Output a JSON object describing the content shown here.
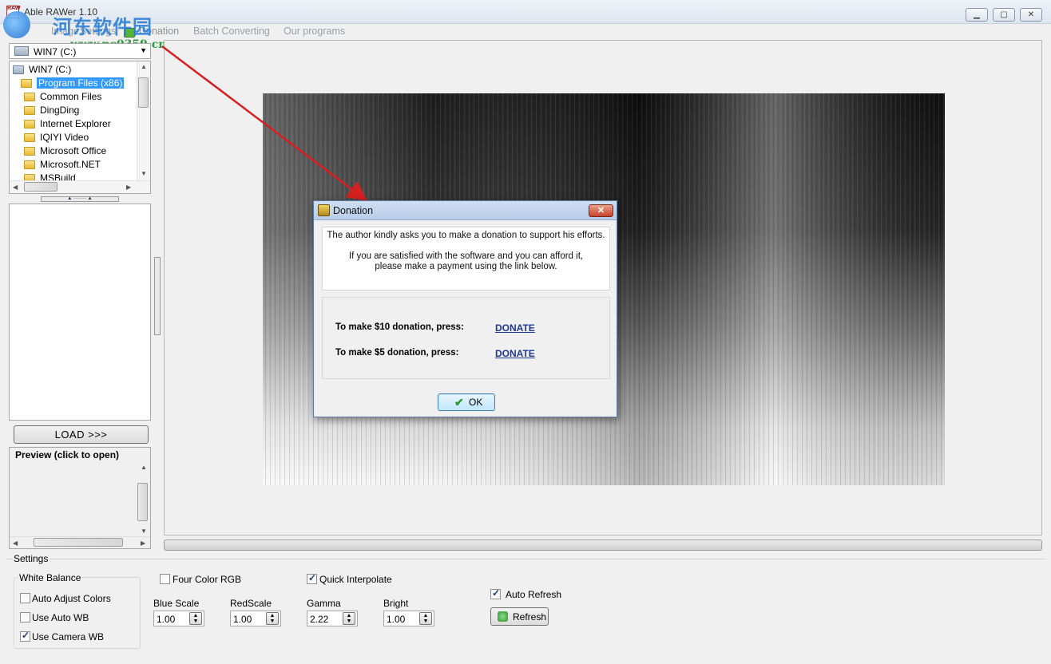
{
  "window": {
    "title": "Able RAWer 1.10",
    "controls": [
      "minimize",
      "maximize",
      "close"
    ]
  },
  "watermark": {
    "title": "河东软件园",
    "url": "www.pc0359.cn"
  },
  "menu": {
    "items": [
      {
        "label": "Image"
      },
      {
        "label": "Settings"
      },
      {
        "label": "Donation"
      },
      {
        "label": "Batch Converting"
      },
      {
        "label": "Our programs"
      }
    ]
  },
  "sidebar": {
    "drive": "WIN7 (C:)",
    "tree": [
      {
        "label": "WIN7 (C:)",
        "icon": "drive-icon",
        "level": 0
      },
      {
        "label": "Program Files (x86)",
        "icon": "folder-icon",
        "level": 1,
        "selected": true
      },
      {
        "label": "Common Files",
        "icon": "folder-icon",
        "level": 2
      },
      {
        "label": "DingDing",
        "icon": "folder-icon",
        "level": 2
      },
      {
        "label": "Internet Explorer",
        "icon": "folder-icon",
        "level": 2
      },
      {
        "label": "IQIYI Video",
        "icon": "folder-icon",
        "level": 2
      },
      {
        "label": "Microsoft Office",
        "icon": "folder-icon",
        "level": 2
      },
      {
        "label": "Microsoft.NET",
        "icon": "folder-icon",
        "level": 2
      },
      {
        "label": "MSBuild",
        "icon": "folder-icon",
        "level": 2
      }
    ],
    "load_label": "LOAD >>>",
    "preview_title": "Preview (click to open)"
  },
  "settings": {
    "legend": "Settings",
    "white_balance": {
      "legend": "White Balance",
      "auto_adjust": {
        "label": "Auto Adjust Colors",
        "checked": false
      },
      "use_auto_wb": {
        "label": "Use Auto WB",
        "checked": false
      },
      "use_camera_wb": {
        "label": "Use Camera WB",
        "checked": true
      }
    },
    "four_color_rgb": {
      "label": "Four Color RGB",
      "checked": false
    },
    "quick_interpolate": {
      "label": "Quick Interpolate",
      "checked": true
    },
    "blue_scale": {
      "label": "Blue Scale",
      "value": "1.00"
    },
    "red_scale": {
      "label": "RedScale",
      "value": "1.00"
    },
    "gamma": {
      "label": "Gamma",
      "value": "2.22"
    },
    "bright": {
      "label": "Bright",
      "value": "1.00"
    },
    "auto_refresh": {
      "label": "Auto Refresh",
      "checked": true
    },
    "refresh_label": "Refresh"
  },
  "dialog": {
    "title": "Donation",
    "message_1": "The author kindly asks you to make a donation to support his efforts.",
    "message_2": "If you are satisfied with the software and you can afford it,",
    "message_3": "please make a payment using the link below.",
    "donate_10_text": "To make $10 donation, press:",
    "donate_5_text": "To make $5 donation, press:",
    "donate_link": "DONATE",
    "ok_label": "OK",
    "close_glyph": "✕"
  },
  "colors": {
    "accent": "#3399ff",
    "link": "#1a3a9a",
    "annotation_arrow": "#d62020"
  }
}
